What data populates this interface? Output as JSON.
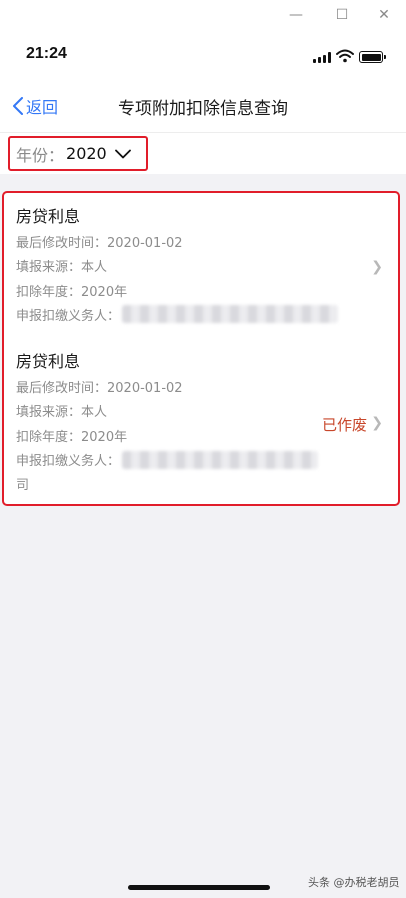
{
  "window_controls": {
    "minimize": "—",
    "maximize": "☐",
    "close": "✕"
  },
  "status_bar": {
    "time": "21:24"
  },
  "nav": {
    "back_label": "返回",
    "title": "专项附加扣除信息查询"
  },
  "filter": {
    "year_label": "年份：",
    "year_value": "2020"
  },
  "records": [
    {
      "title": "房贷利息",
      "modified": "最后修改时间：2020-01-02",
      "source": "填报来源：本人",
      "deduction_year": "扣除年度：2020年",
      "withholding_agent_label": "申报扣缴义务人：",
      "status": ""
    },
    {
      "title": "房贷利息",
      "modified": "最后修改时间：2020-01-02",
      "source": "填报来源：本人",
      "deduction_year": "扣除年度：2020年",
      "withholding_agent_label": "申报扣缴义务人：",
      "withholding_agent_suffix": "司",
      "status": "已作废"
    }
  ],
  "watermark": "头条 @办税老胡员"
}
